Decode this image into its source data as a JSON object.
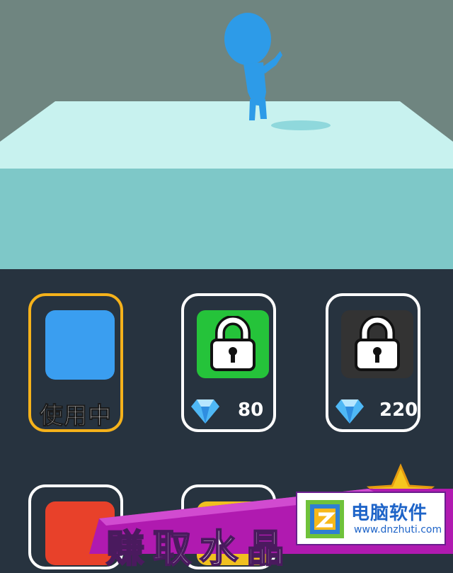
{
  "scene": {
    "background_color": "#6f8580",
    "platform_top_color": "#c8f2ef",
    "platform_front_color": "#7ec8c8",
    "character_color": "#2d9be8"
  },
  "shop": {
    "items": [
      {
        "id": "blue",
        "color": "#3a9ef0",
        "state": "selected",
        "status_label": "使用中"
      },
      {
        "id": "green",
        "color": "#25c33a",
        "state": "locked",
        "price": "80",
        "currency_icon": "diamond-icon"
      },
      {
        "id": "black",
        "color": "#333333",
        "state": "locked",
        "price": "220",
        "currency_icon": "diamond-icon"
      }
    ],
    "bottom_items": [
      {
        "id": "red",
        "color": "#e8412a"
      },
      {
        "id": "yellow",
        "color": "#f0c020"
      }
    ]
  },
  "banner": {
    "text": "赚取水晶"
  },
  "watermark": {
    "title": "电脑软件",
    "url": "www.dnzhuti.com"
  }
}
